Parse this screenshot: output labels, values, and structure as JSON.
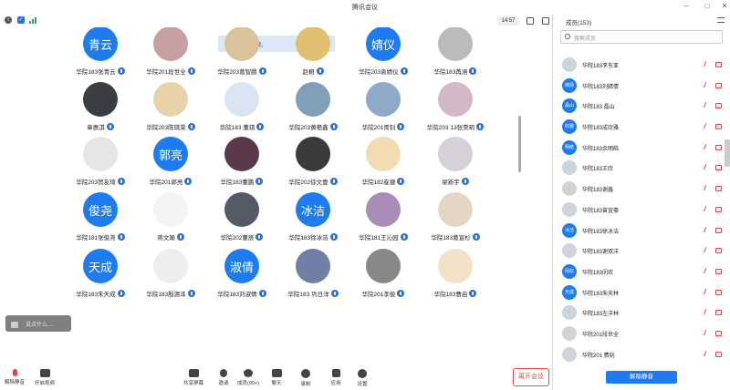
{
  "window": {
    "title": "腾讯会议"
  },
  "infobar": {
    "timer": "14:57"
  },
  "speaker": {
    "text": "正在讲话: 席晓;"
  },
  "tiles": [
    {
      "name": "华院183张青云",
      "avatar_text": "青云",
      "avatar_type": "text"
    },
    {
      "name": "华院201段世全",
      "avatar_text": "",
      "avatar_type": "photo",
      "color": "#c9a0a0"
    },
    {
      "name": "华院203葛智鹏",
      "avatar_text": "",
      "avatar_type": "photo",
      "color": "#d8c39a"
    },
    {
      "name": "赵桐",
      "avatar_text": "",
      "avatar_type": "photo",
      "color": "#e0c070"
    },
    {
      "name": "华院203袁婧仪",
      "avatar_text": "婧仪",
      "avatar_type": "text"
    },
    {
      "name": "华院183苒涵",
      "avatar_text": "",
      "avatar_type": "photo",
      "color": "#bbb"
    },
    {
      "name": "章惠淇",
      "avatar_text": "",
      "avatar_type": "photo",
      "color": "#3a3d44"
    },
    {
      "name": "华院203陈琪荣",
      "avatar_text": "",
      "avatar_type": "photo",
      "color": "#e8d2a8"
    },
    {
      "name": "华院183 董琪",
      "avatar_text": "",
      "avatar_type": "photo",
      "color": "#d9e6f2"
    },
    {
      "name": "华院203黄艳鑫",
      "avatar_text": "",
      "avatar_type": "photo",
      "color": "#7fa0b8"
    },
    {
      "name": "华院201胥钊",
      "avatar_text": "",
      "avatar_type": "photo",
      "color": "#8fa9c8"
    },
    {
      "name": "华院203 13张昊玥",
      "avatar_text": "",
      "avatar_type": "photo",
      "color": "#d4b8c6"
    },
    {
      "name": "华院203贺友琦",
      "avatar_text": "",
      "avatar_type": "photo",
      "color": "#e6e6e6"
    },
    {
      "name": "华院201郭亮",
      "avatar_text": "郭亮",
      "avatar_type": "text"
    },
    {
      "name": "华院183董鹏",
      "avatar_text": "",
      "avatar_type": "photo",
      "color": "#5a3a4a"
    },
    {
      "name": "华院202徐文壹",
      "avatar_text": "",
      "avatar_type": "photo",
      "color": "#3a3a3a"
    },
    {
      "name": "华院182崔捷",
      "avatar_text": "",
      "avatar_type": "photo",
      "color": "#f0dcb0"
    },
    {
      "name": "梁新宇",
      "avatar_text": "",
      "avatar_type": "photo",
      "color": "#d6d0d8"
    },
    {
      "name": "华院181张俊尧",
      "avatar_text": "俊尧",
      "avatar_type": "text"
    },
    {
      "name": "蒋文瀚",
      "avatar_text": "",
      "avatar_type": "photo",
      "color": "#f4f4f4"
    },
    {
      "name": "华院202董辰",
      "avatar_text": "",
      "avatar_type": "photo",
      "color": "#555b66"
    },
    {
      "name": "华院183徐冰洁",
      "avatar_text": "冰洁",
      "avatar_type": "text"
    },
    {
      "name": "华院181王沁园",
      "avatar_text": "",
      "avatar_type": "photo",
      "color": "#a98cb8"
    },
    {
      "name": "华院183葛宣杉",
      "avatar_text": "",
      "avatar_type": "photo",
      "color": "#e4d6c4"
    },
    {
      "name": "华院183朱天成",
      "avatar_text": "天成",
      "avatar_type": "text"
    },
    {
      "name": "华院183殷源泽",
      "avatar_text": "",
      "avatar_type": "photo",
      "color": "#eeeeee"
    },
    {
      "name": "华院183刘淑倩",
      "avatar_text": "淑倩",
      "avatar_type": "text"
    },
    {
      "name": "华院183 巩日洋",
      "avatar_text": "",
      "avatar_type": "photo",
      "color": "#6f7fa8"
    },
    {
      "name": "华院201李俊",
      "avatar_text": "",
      "avatar_type": "photo",
      "color": "#888888"
    },
    {
      "name": "华院183曹启",
      "avatar_text": "",
      "avatar_type": "photo",
      "color": "#f2e2c8"
    }
  ],
  "chat": {
    "placeholder": "说点什么..."
  },
  "toolbar": {
    "mute": "解除静音",
    "video": "开启视频",
    "share": "共享屏幕",
    "invite": "邀请",
    "members": "成员(99+)",
    "chat": "聊天",
    "record": "录制",
    "apps": "应用",
    "settings": "设置",
    "leave": "离开会议"
  },
  "panel": {
    "header": "成员(153)",
    "search_placeholder": "搜索成员",
    "unmute_all": "解除静音",
    "members": [
      {
        "name": "华院183李东亚",
        "avatar_text": "",
        "blue": false
      },
      {
        "name": "华院183刘婧倩",
        "avatar_text": "婧倩",
        "blue": true
      },
      {
        "name": "华院183 晶山",
        "avatar_text": "晶山",
        "blue": true
      },
      {
        "name": "华院183成欣雅",
        "avatar_text": "欣雅",
        "blue": true
      },
      {
        "name": "华院183余明皓",
        "avatar_text": "明皓",
        "blue": true
      },
      {
        "name": "华院183王欣",
        "avatar_text": "",
        "blue": false
      },
      {
        "name": "华院183谢鑫",
        "avatar_text": "",
        "blue": false
      },
      {
        "name": "华院183曾宣豪",
        "avatar_text": "",
        "blue": false
      },
      {
        "name": "华院183徐冰洁",
        "avatar_text": "冰洁",
        "blue": true
      },
      {
        "name": "华院183谢双洋",
        "avatar_text": "",
        "blue": false
      },
      {
        "name": "华院183闵欢",
        "avatar_text": "闵欢",
        "blue": true
      },
      {
        "name": "华院183朱天林",
        "avatar_text": "天成",
        "blue": true
      },
      {
        "name": "华院183左洋林",
        "avatar_text": "",
        "blue": false
      },
      {
        "name": "华院201段世全",
        "avatar_text": "",
        "blue": false
      },
      {
        "name": "华院201 费钊",
        "avatar_text": "",
        "blue": false
      }
    ]
  }
}
